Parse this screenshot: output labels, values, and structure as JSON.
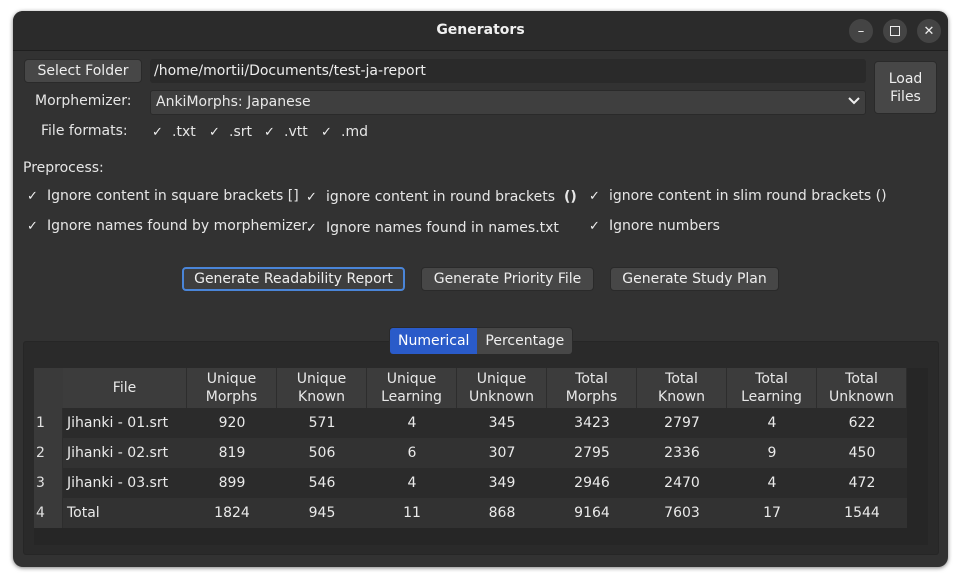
{
  "window": {
    "title": "Generators"
  },
  "controls": {
    "select_folder_label": "Select Folder",
    "folder_path": "/home/mortii/Documents/test-ja-report",
    "load_files_line1": "Load",
    "load_files_line2": "Files",
    "morphemizer_label": "Morphemizer:",
    "morphemizer_value": "AnkiMorphs: Japanese",
    "file_formats_label": "File formats:",
    "formats": [
      ".txt",
      ".srt",
      ".vtt",
      ".md"
    ]
  },
  "preprocess": {
    "label": "Preprocess:",
    "options": [
      "Ignore content in square brackets []",
      "ignore content in round brackets",
      "ignore content in slim round brackets ()",
      "Ignore names found by morphemizer",
      "Ignore names found in names.txt",
      "Ignore numbers"
    ],
    "round_brackets_glyph": "()"
  },
  "actions": {
    "readability": "Generate Readability Report",
    "priority": "Generate Priority File",
    "study_plan": "Generate Study Plan"
  },
  "tabs": {
    "numerical": "Numerical",
    "percentage": "Percentage"
  },
  "table": {
    "headers": [
      [
        "File",
        ""
      ],
      [
        "Unique",
        "Morphs"
      ],
      [
        "Unique",
        "Known"
      ],
      [
        "Unique",
        "Learning"
      ],
      [
        "Unique",
        "Unknown"
      ],
      [
        "Total",
        "Morphs"
      ],
      [
        "Total",
        "Known"
      ],
      [
        "Total",
        "Learning"
      ],
      [
        "Total",
        "Unknown"
      ]
    ],
    "rows": [
      {
        "num": "1",
        "cells": [
          "Jihanki - 01.srt",
          "920",
          "571",
          "4",
          "345",
          "3423",
          "2797",
          "4",
          "622"
        ]
      },
      {
        "num": "2",
        "cells": [
          "Jihanki - 02.srt",
          "819",
          "506",
          "6",
          "307",
          "2795",
          "2336",
          "9",
          "450"
        ]
      },
      {
        "num": "3",
        "cells": [
          "Jihanki - 03.srt",
          "899",
          "546",
          "4",
          "349",
          "2946",
          "2470",
          "4",
          "472"
        ]
      },
      {
        "num": "4",
        "cells": [
          "Total",
          "1824",
          "945",
          "11",
          "868",
          "9164",
          "7603",
          "17",
          "1544"
        ]
      }
    ]
  }
}
